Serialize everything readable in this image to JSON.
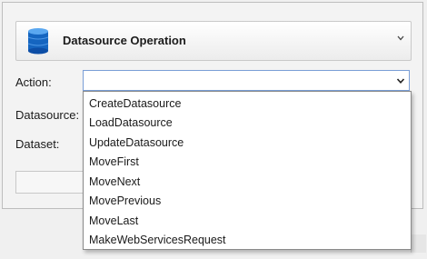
{
  "header": {
    "title": "Datasource Operation",
    "icon": "database-icon",
    "icon_color": "#1565c0"
  },
  "form": {
    "action_label": "Action:",
    "action_value": "",
    "datasource_label": "Datasource:",
    "dataset_label": "Dataset:"
  },
  "dropdown": {
    "options": [
      "CreateDatasource",
      "LoadDatasource",
      "UpdateDatasource",
      "MoveFirst",
      "MoveNext",
      "MovePrevious",
      "MoveLast",
      "MakeWebServicesRequest"
    ]
  },
  "colors": {
    "focus_border": "#7a9ed6",
    "background": "#f0f0f0"
  }
}
